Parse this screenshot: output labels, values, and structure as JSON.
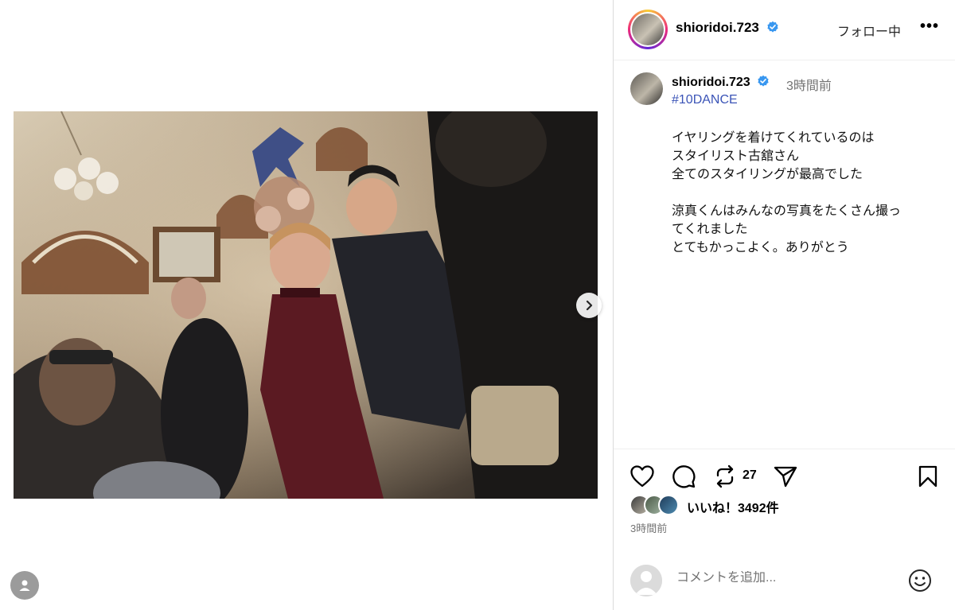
{
  "post": {
    "username": "shioridoi.723",
    "follow_label": "フォロー中",
    "more_label": "•••",
    "timestamp_short": "3時間前",
    "hashtag": "#10DANCE",
    "caption_lines": [
      "イヤリングを着けてくれているのは",
      "スタイリスト古舘さん",
      "全てのスタイリングが最高でした",
      "",
      "涼真くんはみんなの写真をたくさん撮っ",
      "てくれました",
      "とてもかっこよく。ありがとう"
    ],
    "repost_count": "27",
    "likes_text": "いいね！3492件",
    "post_time": "3時間前"
  },
  "comment": {
    "placeholder": "コメントを追加..."
  },
  "colors": {
    "verified": "#3897f0",
    "hashtag": "#3b54b7",
    "secondary_text": "#737373",
    "divider": "#dbdbdb"
  },
  "icons": {
    "verified": "verified-badge-icon",
    "like": "heart-icon",
    "comment": "comment-icon",
    "repost": "repost-icon",
    "share": "paper-plane-icon",
    "save": "bookmark-icon",
    "next": "chevron-right-icon",
    "emoji": "smiley-icon",
    "user": "user-silhouette-icon"
  }
}
